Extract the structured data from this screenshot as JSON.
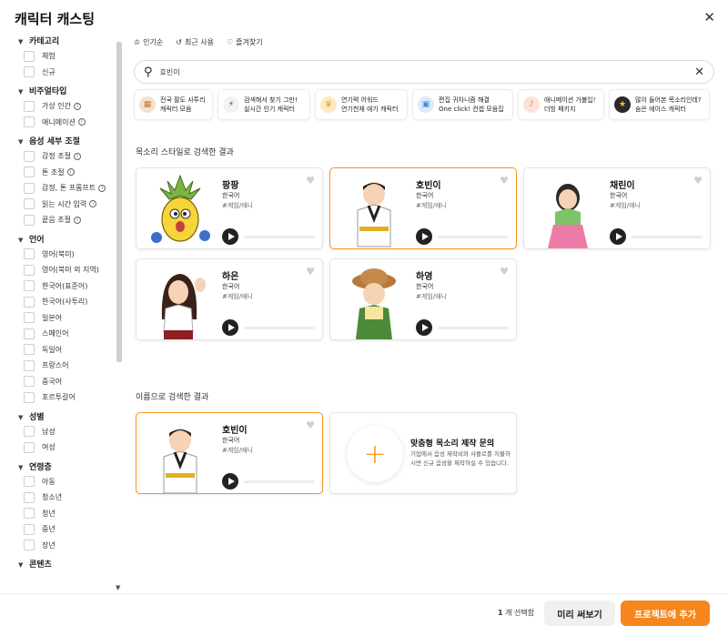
{
  "dialog": {
    "title": "캐릭터 캐스팅"
  },
  "sidebar": {
    "sections": [
      {
        "label": "카테고리",
        "options": [
          {
            "label": "체험"
          },
          {
            "label": "신규"
          }
        ]
      },
      {
        "label": "비주얼타입",
        "options": [
          {
            "label": "가상 인간",
            "info": true
          },
          {
            "label": "애니메이션",
            "info": true
          }
        ]
      },
      {
        "label": "음성 세부 조절",
        "options": [
          {
            "label": "감정 조절",
            "info": true
          },
          {
            "label": "톤 조절",
            "info": true
          },
          {
            "label": "감정, 톤 프롬프트",
            "info": true
          },
          {
            "label": "읽는 시간 입력",
            "info": true
          },
          {
            "label": "끝음 조절",
            "info": true
          }
        ]
      },
      {
        "label": "언어",
        "options": [
          {
            "label": "영어(북미)"
          },
          {
            "label": "영어(북미 외 지역)"
          },
          {
            "label": "한국어(표준어)"
          },
          {
            "label": "한국어(사투리)"
          },
          {
            "label": "일본어"
          },
          {
            "label": "스페인어"
          },
          {
            "label": "독일어"
          },
          {
            "label": "프랑스어"
          },
          {
            "label": "중국어"
          },
          {
            "label": "포르투갈어"
          }
        ]
      },
      {
        "label": "성별",
        "options": [
          {
            "label": "남성"
          },
          {
            "label": "여성"
          }
        ]
      },
      {
        "label": "연령층",
        "options": [
          {
            "label": "아동"
          },
          {
            "label": "청소년"
          },
          {
            "label": "청년"
          },
          {
            "label": "중년"
          },
          {
            "label": "장년"
          }
        ]
      },
      {
        "label": "콘텐츠",
        "options": []
      }
    ]
  },
  "quick_filters": [
    "인기순",
    "최근 사용",
    "즐겨찾기"
  ],
  "search": {
    "value": "호빈이",
    "placeholder": ""
  },
  "banners": [
    {
      "line1": "전국 팔도 사투리",
      "line2": "캐릭터 모음",
      "icon_color": "#e8a25c"
    },
    {
      "line1": "검색해서 찾기 그만!",
      "line2": "실시간 인기 캐릭터",
      "icon_color": "#333333"
    },
    {
      "line1": "연기력 어워드",
      "line2": "연기천재 애기 캐릭터",
      "icon_color": "#f2b63a"
    },
    {
      "line1": "편집 귀차니즘 해결",
      "line2": "One click! 컨셉 모음집",
      "icon_color": "#3a8ee6"
    },
    {
      "line1": "애니메이션 가볼입!",
      "line2": "더빙 패키지",
      "icon_color": "#f28c6a"
    },
    {
      "line1": "많이 들어본 목소리인데?",
      "line2": "숨은 에이스 캐릭터",
      "icon_color": "#2a2a2a"
    }
  ],
  "style_results": {
    "title": "목소리 스타일로 검색한 결과",
    "cards": [
      {
        "name": "팡팡",
        "lang": "한국어",
        "tag": "#게임/애니",
        "selected": false
      },
      {
        "name": "호빈이",
        "lang": "한국어",
        "tag": "#게임/애니",
        "selected": true
      },
      {
        "name": "채린이",
        "lang": "한국어",
        "tag": "#게임/애니",
        "selected": false
      },
      {
        "name": "하은",
        "lang": "한국어",
        "tag": "#게임/애니",
        "selected": false
      },
      {
        "name": "하영",
        "lang": "한국어",
        "tag": "#게임/애니",
        "selected": false
      }
    ]
  },
  "name_results": {
    "title": "이름으로 검색한 결과",
    "cards": [
      {
        "name": "호빈이",
        "lang": "한국어",
        "tag": "#게임/애니",
        "selected": true
      }
    ],
    "inquiry": {
      "title": "맞춤형 목소리 제작 문의",
      "desc": "기업에서 음성 제작비와 샤플르를 지불하시면 신규 음성을 제작하실 수 있습니다."
    }
  },
  "footer": {
    "count": "1",
    "count_suffix": "개 선택함",
    "preview_label": "미리 써보기",
    "add_label": "프로젝트에 추가"
  },
  "colors": {
    "accent": "#f7861d",
    "selected_border": "#f7941d"
  }
}
